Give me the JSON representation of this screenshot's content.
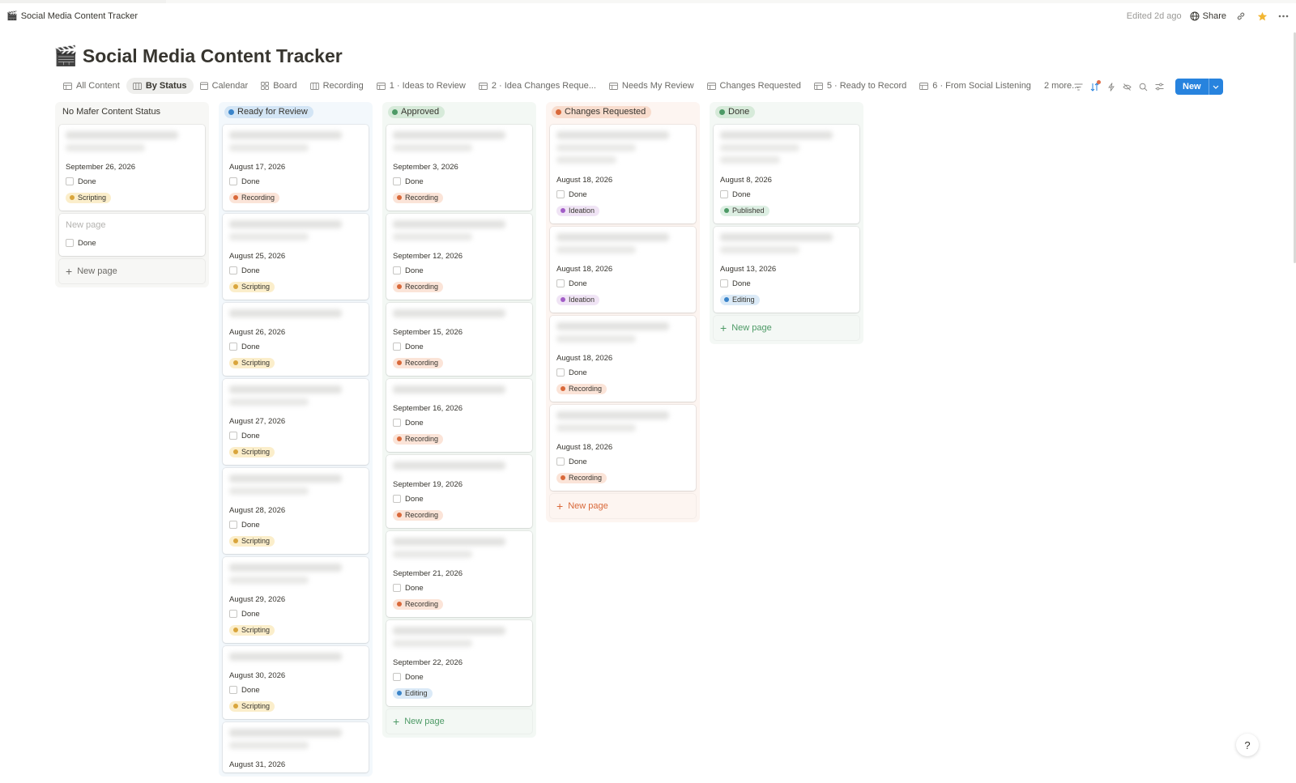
{
  "topbar": {
    "page_icon": "🎬",
    "page_name": "Social Media Content Tracker",
    "edited": "Edited 2d ago",
    "share": "Share"
  },
  "title": {
    "emoji": "🎬",
    "text": "Social Media Content Tracker"
  },
  "views": [
    {
      "label": "All Content",
      "icon": "table-icon",
      "active": false
    },
    {
      "label": "By Status",
      "icon": "board-icon",
      "active": true
    },
    {
      "label": "Calendar",
      "icon": "calendar-icon",
      "active": false
    },
    {
      "label": "Board",
      "icon": "gallery-icon",
      "active": false
    },
    {
      "label": "Recording",
      "icon": "board-icon",
      "active": false
    },
    {
      "label": "1 · Ideas to Review",
      "icon": "table-icon",
      "active": false
    },
    {
      "label": "2 · Idea Changes Reque...",
      "icon": "table-icon",
      "active": false
    },
    {
      "label": "Needs My Review",
      "icon": "table-icon",
      "active": false
    },
    {
      "label": "Changes Requested",
      "icon": "table-icon",
      "active": false
    },
    {
      "label": "5 · Ready to Record",
      "icon": "table-icon",
      "active": false
    },
    {
      "label": "6 · From Social Listening",
      "icon": "table-icon",
      "active": false
    }
  ],
  "views_more": "2 more...",
  "new_button": "New",
  "done_label": "Done",
  "new_page_label": "New page",
  "tag_colors": {
    "Scripting": {
      "bg": "#fbeecb",
      "dot": "#d9a53c"
    },
    "Recording": {
      "bg": "#fbe4d8",
      "dot": "#d9693a"
    },
    "Ideation": {
      "bg": "#f0e4f5",
      "dot": "#a25dc7"
    },
    "Editing": {
      "bg": "#dbeaf7",
      "dot": "#3a84c9"
    },
    "Published": {
      "bg": "#ddefe3",
      "dot": "#4d9a66"
    }
  },
  "columns": [
    {
      "name": "No Mafer Content Status",
      "style": "plain",
      "bg": "#f7f7f5",
      "pill_bg": "",
      "dot": "",
      "newpage_color": "#6b6a66",
      "cards": [
        {
          "date": "September 26, 2026",
          "tag": "Scripting",
          "blur": "normal"
        }
      ],
      "empty_card": {
        "title": "New page"
      }
    },
    {
      "name": "Ready for Review",
      "style": "pill",
      "bg": "#f3f8fc",
      "pill_bg": "#d3e5f5",
      "dot": "#3a84c9",
      "newpage_color": "#3a84c9",
      "cards": [
        {
          "date": "August 17, 2026",
          "tag": "Recording",
          "blur": "normal"
        },
        {
          "date": "August 25, 2026",
          "tag": "Scripting",
          "blur": "normal"
        },
        {
          "date": "August 26, 2026",
          "tag": "Scripting",
          "blur": "short"
        },
        {
          "date": "August 27, 2026",
          "tag": "Scripting",
          "blur": "normal"
        },
        {
          "date": "August 28, 2026",
          "tag": "Scripting",
          "blur": "normal"
        },
        {
          "date": "August 29, 2026",
          "tag": "Scripting",
          "blur": "normal"
        },
        {
          "date": "August 30, 2026",
          "tag": "Scripting",
          "blur": "short"
        },
        {
          "date": "August 31, 2026",
          "tag": "",
          "blur": "normal"
        }
      ]
    },
    {
      "name": "Approved",
      "style": "pill",
      "bg": "#f3f8f4",
      "pill_bg": "#d6ead9",
      "dot": "#4d9a66",
      "newpage_color": "#4d9a66",
      "cards": [
        {
          "date": "September 3, 2026",
          "tag": "Recording",
          "blur": "normal"
        },
        {
          "date": "September 12, 2026",
          "tag": "Recording",
          "blur": "normal"
        },
        {
          "date": "September 15, 2026",
          "tag": "Recording",
          "blur": "short"
        },
        {
          "date": "September 16, 2026",
          "tag": "Recording",
          "blur": "short"
        },
        {
          "date": "September 19, 2026",
          "tag": "Recording",
          "blur": "short"
        },
        {
          "date": "September 21, 2026",
          "tag": "Recording",
          "blur": "normal"
        },
        {
          "date": "September 22, 2026",
          "tag": "Editing",
          "blur": "normal"
        }
      ],
      "new_page": true
    },
    {
      "name": "Changes Requested",
      "style": "pill",
      "bg": "#fdf5f1",
      "pill_bg": "#f8dccd",
      "dot": "#d9693a",
      "newpage_color": "#d9693a",
      "cards": [
        {
          "date": "August 18, 2026",
          "tag": "Ideation",
          "blur": "tall"
        },
        {
          "date": "August 18, 2026",
          "tag": "Ideation",
          "blur": "normal"
        },
        {
          "date": "August 18, 2026",
          "tag": "Recording",
          "blur": "normal"
        },
        {
          "date": "August 18, 2026",
          "tag": "Recording",
          "blur": "normal"
        }
      ],
      "new_page": true
    },
    {
      "name": "Done",
      "style": "pill",
      "bg": "#f4f8f5",
      "pill_bg": "#d6ead9",
      "dot": "#4d9a66",
      "newpage_color": "#4d9a66",
      "cards": [
        {
          "date": "August 8, 2026",
          "tag": "Published",
          "blur": "tall"
        },
        {
          "date": "August 13, 2026",
          "tag": "Editing",
          "blur": "normal"
        }
      ],
      "new_page": true
    }
  ]
}
